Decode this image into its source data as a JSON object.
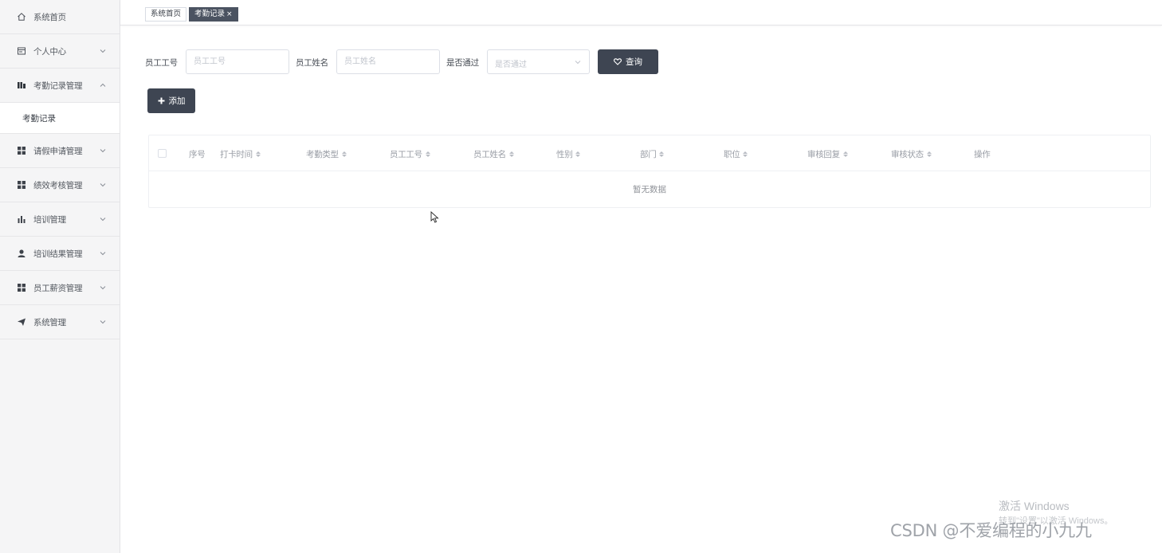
{
  "sidebar": {
    "items": [
      {
        "label": "系统首页",
        "icon": "home-icon",
        "has_children": false
      },
      {
        "label": "个人中心",
        "icon": "user-card-icon",
        "has_children": true
      },
      {
        "label": "考勤记录管理",
        "icon": "bar-report-icon",
        "has_children": true,
        "expanded": true,
        "children": [
          {
            "label": "考勤记录",
            "active": true
          }
        ]
      },
      {
        "label": "请假申请管理",
        "icon": "grid-icon",
        "has_children": true
      },
      {
        "label": "绩效考核管理",
        "icon": "grid-icon",
        "has_children": true
      },
      {
        "label": "培训管理",
        "icon": "bar-chart-icon",
        "has_children": true
      },
      {
        "label": "培训结果管理",
        "icon": "person-icon",
        "has_children": true
      },
      {
        "label": "员工薪资管理",
        "icon": "grid-icon",
        "has_children": true
      },
      {
        "label": "系统管理",
        "icon": "send-icon",
        "has_children": true
      }
    ]
  },
  "tabs": [
    {
      "label": "系统首页",
      "active": false
    },
    {
      "label": "考勤记录",
      "active": true,
      "close": "×"
    }
  ],
  "search": {
    "employee_no_label": "员工工号",
    "employee_no_placeholder": "员工工号",
    "employee_name_label": "员工姓名",
    "employee_name_placeholder": "员工姓名",
    "approved_label": "是否通过",
    "approved_placeholder": "是否通过",
    "query_button": "查询"
  },
  "toolbar": {
    "add_button": "添加"
  },
  "table": {
    "columns": [
      {
        "label": "序号",
        "sortable": false
      },
      {
        "label": "打卡时间",
        "sortable": true
      },
      {
        "label": "考勤类型",
        "sortable": true
      },
      {
        "label": "员工工号",
        "sortable": true
      },
      {
        "label": "员工姓名",
        "sortable": true
      },
      {
        "label": "性别",
        "sortable": true
      },
      {
        "label": "部门",
        "sortable": true
      },
      {
        "label": "职位",
        "sortable": true
      },
      {
        "label": "审核回复",
        "sortable": true
      },
      {
        "label": "审核状态",
        "sortable": true
      },
      {
        "label": "操作",
        "sortable": false
      }
    ],
    "empty_text": "暂无数据",
    "rows": []
  },
  "watermarks": {
    "windows_line1": "激活 Windows",
    "windows_line2": "转到\"设置\"以激活 Windows。",
    "csdn": "CSDN @不爱编程的小九九"
  },
  "colors": {
    "sidebar_bg": "#f5f5f6",
    "active_tab_bg": "#4b5361",
    "primary_button": "#3e4552"
  }
}
